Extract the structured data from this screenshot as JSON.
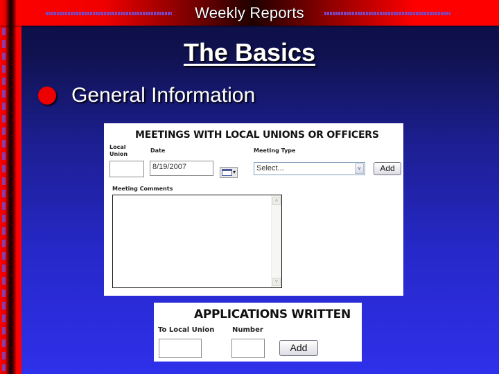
{
  "header": {
    "title": "Weekly Reports"
  },
  "slide": {
    "title": "The Basics",
    "bullets": [
      {
        "text": "General Information",
        "color": "#ee0000"
      }
    ]
  },
  "colors": {
    "header_red": "#ff0000",
    "background_top": "#0c0d40",
    "background_bottom": "#2f30ea",
    "bullet": "#ee0000"
  },
  "meetings_form": {
    "title": "MEETINGS WITH LOCAL UNIONS OR OFFICERS",
    "local_union_label_line1": "Local",
    "local_union_label_line2": "Union",
    "local_union_value": "",
    "date_label": "Date",
    "date_value": "8/19/2007",
    "meeting_type_label": "Meeting Type",
    "meeting_type_selected": "Select...",
    "add_button": "Add",
    "comments_label": "Meeting Comments",
    "comments_value": "",
    "icons": {
      "calendar": "calendar-icon",
      "dropdown": "chevron-down-icon",
      "scroll_up": "˄",
      "scroll_down": "˅",
      "select_arrow": "˅",
      "cal_arrow": "▾"
    }
  },
  "applications_form": {
    "title": "APPLICATIONS WRITTEN",
    "to_local_union_label": "To Local Union",
    "to_local_union_value": "",
    "number_label": "Number",
    "number_value": "",
    "add_button": "Add"
  }
}
